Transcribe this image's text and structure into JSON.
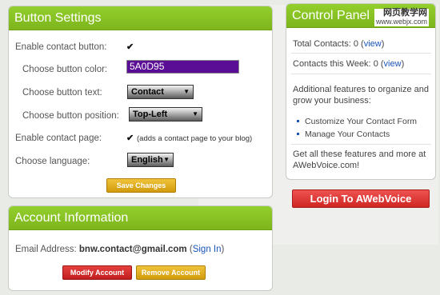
{
  "button_settings": {
    "title": "Button Settings",
    "enable_contact_button_label": "Enable contact button:",
    "enable_contact_button_checked": true,
    "button_color_label": "Choose button color:",
    "button_color_value": "5A0D95",
    "button_text_label": "Choose button text:",
    "button_text_value": "Contact",
    "button_position_label": "Choose button position:",
    "button_position_value": "Top-Left",
    "enable_contact_page_label": "Enable contact page:",
    "enable_contact_page_checked": true,
    "contact_page_note": "(adds a contact page to your blog)",
    "language_label": "Choose language:",
    "language_value": "English",
    "save_label": "Save Changes",
    "checkmark": "✔",
    "arrow": "▼"
  },
  "account_info": {
    "title": "Account Information",
    "email_label": "Email Address:",
    "email_value": "bnw.contact@gmail.com",
    "sign_in_open": "(",
    "sign_in_label": "Sign In",
    "sign_in_close": ")",
    "modify_label": "Modify Account",
    "remove_label": "Remove Account"
  },
  "control_panel": {
    "title": "Control Panel",
    "total_contacts_label": "Total Contacts:",
    "total_contacts_value": "0",
    "total_contacts_link": "view",
    "week_contacts_label": "Contacts this Week:",
    "week_contacts_value": "0",
    "week_contacts_link": "view",
    "features_text": "Additional features to organize and grow your business:",
    "feature_links": [
      "Customize Your Contact Form",
      "Manage Your Contacts"
    ],
    "promo_text": "Get all these features and more at AWebVoice.com!"
  },
  "login_button_label": "Login To AWebVoice",
  "watermark": {
    "main": "网页教学网",
    "sub": "www.webjx.com"
  },
  "colors": {
    "header_green": "#86c124",
    "button_color_swatch": "#5A0D95",
    "gold_button": "#e0ad1c",
    "red_button": "#d62b29",
    "link_blue": "#1b55b8"
  }
}
